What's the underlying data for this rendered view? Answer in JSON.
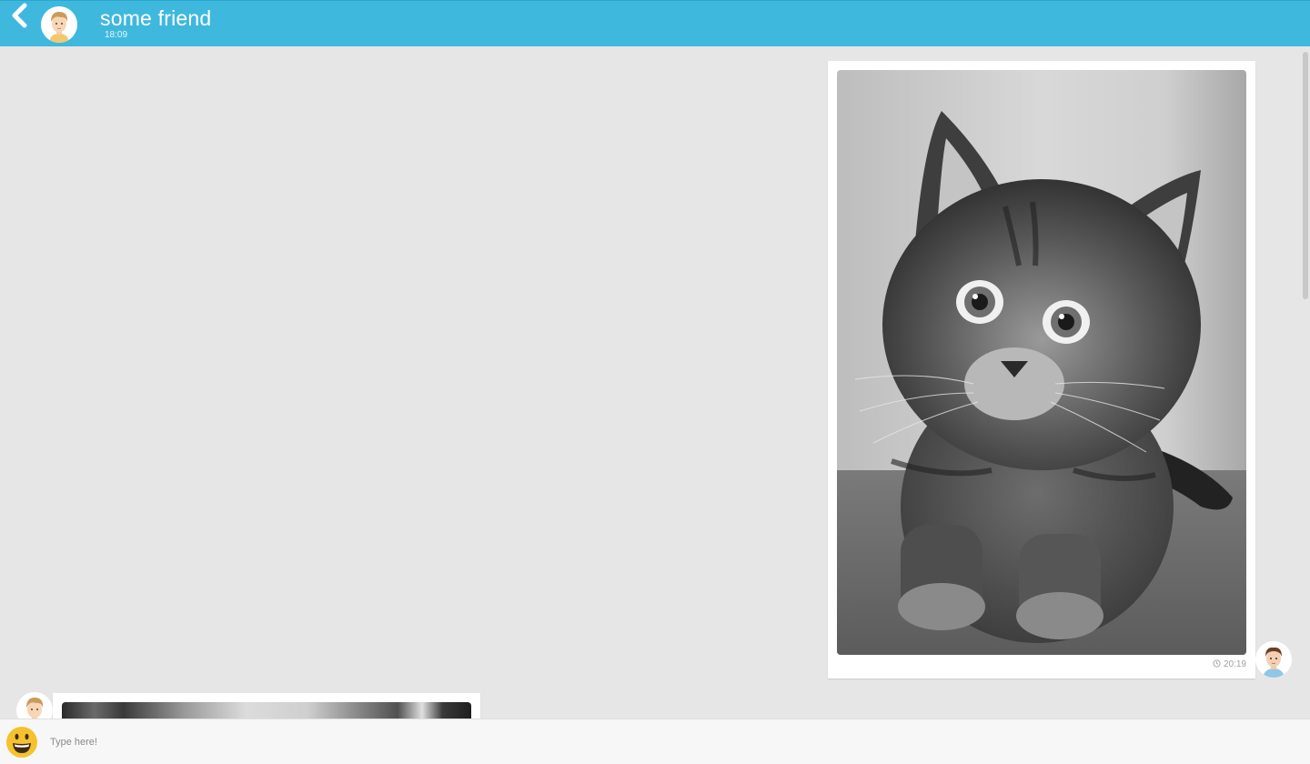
{
  "header": {
    "contact_name": "some friend",
    "last_seen": "18:09",
    "background_color": "#3fb8de",
    "back_icon": "chevron-left-icon",
    "avatar": "friend-avatar"
  },
  "messages": [
    {
      "direction": "outgoing",
      "type": "image",
      "image": "grayscale kitten photo",
      "time": "20:19",
      "time_icon": "clock-icon",
      "avatar": "me-avatar"
    },
    {
      "direction": "incoming",
      "type": "image",
      "image": "grayscale photo (partially visible)",
      "avatar": "friend-avatar"
    }
  ],
  "composer": {
    "placeholder": "Type here!",
    "value": "",
    "emoji_icon": "smiley-emoji-icon"
  }
}
